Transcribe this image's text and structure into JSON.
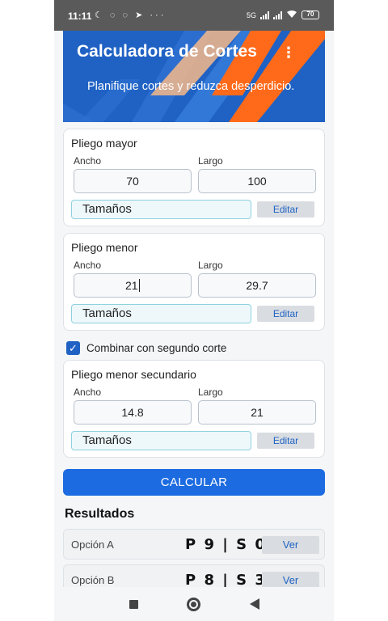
{
  "status_bar": {
    "time": "11:11",
    "left_icons": [
      "moon-icon",
      "messenger-icon",
      "whatsapp-icon",
      "telegram-icon",
      "more-icon"
    ],
    "left_icon_glyphs": "☾ ◌ ◌ ➤ ···",
    "network": "5G",
    "battery": "70"
  },
  "header": {
    "title": "Calculadora de Cortes",
    "subtitle": "Planifique cortes y reduzca desperdicio.",
    "menu_glyph": "⋮"
  },
  "cards": {
    "mayor": {
      "title": "Pliego mayor",
      "width_label": "Ancho",
      "length_label": "Largo",
      "width_value": "70",
      "length_value": "100",
      "sizes_label": "Tamaños",
      "edit_label": "Editar"
    },
    "menor": {
      "title": "Pliego menor",
      "width_label": "Ancho",
      "length_label": "Largo",
      "width_value": "21",
      "length_value": "29.7",
      "sizes_label": "Tamaños",
      "edit_label": "Editar"
    },
    "secundario": {
      "title": "Pliego menor secundario",
      "width_label": "Ancho",
      "length_label": "Largo",
      "width_value": "14.8",
      "length_value": "21",
      "sizes_label": "Tamaños",
      "edit_label": "Editar"
    }
  },
  "combine": {
    "label": "Combinar con segundo corte",
    "checked": true,
    "check_glyph": "✓"
  },
  "calculate_label": "CALCULAR",
  "results": {
    "title": "Resultados",
    "options": [
      {
        "label": "Opción A",
        "value": "P 9 | S 0",
        "button": "Ver"
      },
      {
        "label": "Opción B",
        "value": "P 8 | S 3",
        "button": "Ver"
      }
    ]
  },
  "colors": {
    "primary": "#1d6be0",
    "banner_blue": "#1f62c4",
    "banner_orange": "#ff6a1a"
  }
}
